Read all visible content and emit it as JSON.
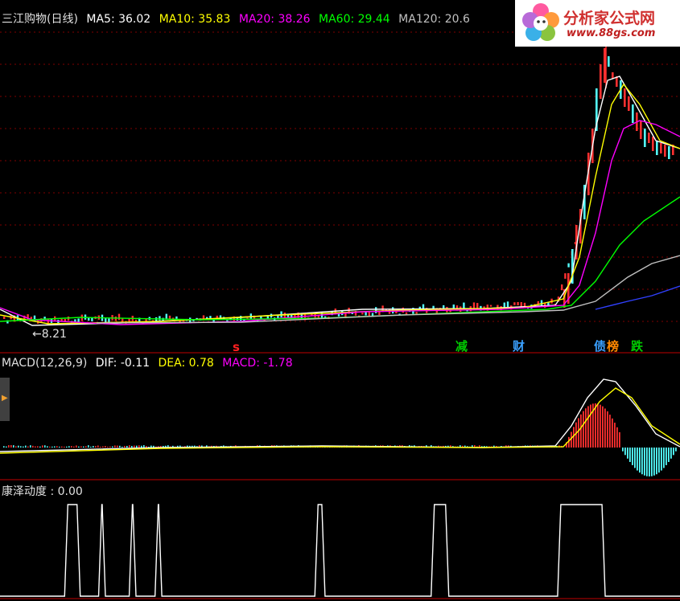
{
  "price_panel": {
    "name": "三江购物(日线)",
    "ma5": {
      "label": "MA5: 36.02",
      "color": "#ffffff"
    },
    "ma10": {
      "label": "MA10: 35.83",
      "color": "#ffff00"
    },
    "ma20": {
      "label": "MA20: 38.26",
      "color": "#ff00ff"
    },
    "ma60": {
      "label": "MA60: 29.44",
      "color": "#00ff00"
    },
    "ma120": {
      "label": "MA120: 20.6",
      "color": "#c0c0c0"
    },
    "low_marker": "8.21",
    "event_tags": [
      {
        "text": "s",
        "color": "#ff2020"
      },
      {
        "text": "减",
        "color": "#00cc00"
      },
      {
        "text": "财",
        "color": "#3aa0ff"
      },
      {
        "text": "债",
        "color": "#3aa0ff"
      },
      {
        "text": "榜",
        "color": "#ff8800"
      },
      {
        "text": "跌",
        "color": "#00cc00"
      }
    ]
  },
  "macd_panel": {
    "name": "MACD(12,26,9)",
    "dif_label": "DIF: -0.11",
    "dea_label": "DEA: 0.78",
    "macd_label": "MACD: -1.78",
    "dif_color": "#ffffff",
    "dea_color": "#ffff00",
    "macd_color": "#ff00ff"
  },
  "indicator_panel": {
    "name": "康泽动度",
    "value_label": ": 0.00"
  },
  "logo": {
    "title": "分析家公式网",
    "url": "www.88gs.com"
  },
  "colors": {
    "background": "#000000",
    "grid": "#800000",
    "up": "#ff3030",
    "down": "#54ffff"
  },
  "chart_data": {
    "type": "line",
    "panels": [
      {
        "name": "price",
        "low": 8.21,
        "high_estimate": 42.5
      },
      {
        "name": "macd"
      },
      {
        "name": "kangze",
        "value": 0.0,
        "pulses_x_fraction": [
          [
            0.095,
            0.118
          ],
          [
            0.145,
            0.155
          ],
          [
            0.19,
            0.2
          ],
          [
            0.228,
            0.238
          ],
          [
            0.463,
            0.478
          ],
          [
            0.634,
            0.66
          ],
          [
            0.82,
            0.89
          ]
        ]
      }
    ]
  }
}
